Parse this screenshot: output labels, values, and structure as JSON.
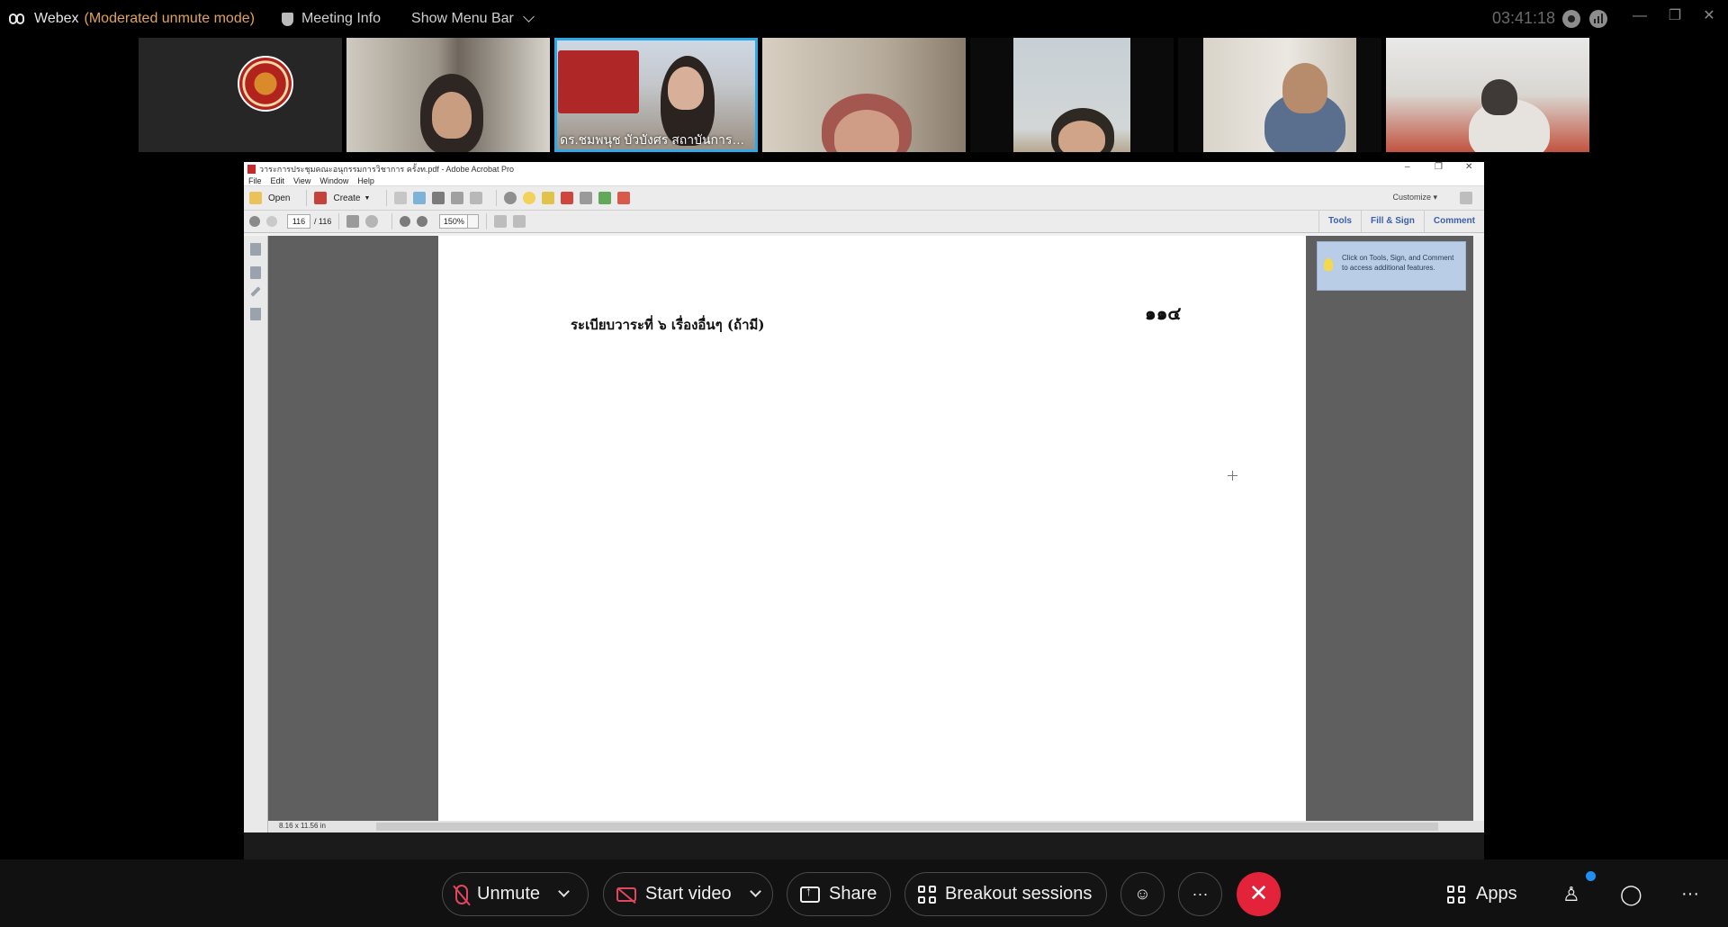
{
  "topbar": {
    "app_name": "Webex",
    "mode": "(Moderated unmute mode)",
    "meeting_info": "Meeting Info",
    "show_menu_bar": "Show Menu Bar",
    "clock": "03:41:18"
  },
  "participants": [
    {
      "name": ""
    },
    {
      "name": ""
    },
    {
      "name": "ดร.ชมพนุช บัวบังศร สถาบันการอาชี..."
    },
    {
      "name": ""
    },
    {
      "name": ""
    },
    {
      "name": ""
    },
    {
      "name": ""
    }
  ],
  "acrobat": {
    "window_title": "วาระการประชุมคณะอนุกรรมการวิชาการ ครั้งท.pdf - Adobe Acrobat Pro",
    "menu": [
      "File",
      "Edit",
      "View",
      "Window",
      "Help"
    ],
    "open_label": "Open",
    "create_label": "Create",
    "customize_label": "Customize",
    "page_current": "116",
    "page_total": "/ 116",
    "zoom": "150%",
    "tabs": [
      "Tools",
      "Fill & Sign",
      "Comment"
    ],
    "tip_text": "Click on Tools, Sign, and Comment to access additional features.",
    "page_size": "8.16 x 11.56 in",
    "doc": {
      "heading": "ระเบียบวาระที่ ๖   เรื่องอื่นๆ (ถ้ามี)",
      "page_number": "๑๑๔"
    }
  },
  "controls": {
    "unmute": "Unmute",
    "start_video": "Start video",
    "share": "Share",
    "breakout": "Breakout sessions",
    "more": "···",
    "end": "✕",
    "apps": "Apps",
    "overflow": "···"
  }
}
